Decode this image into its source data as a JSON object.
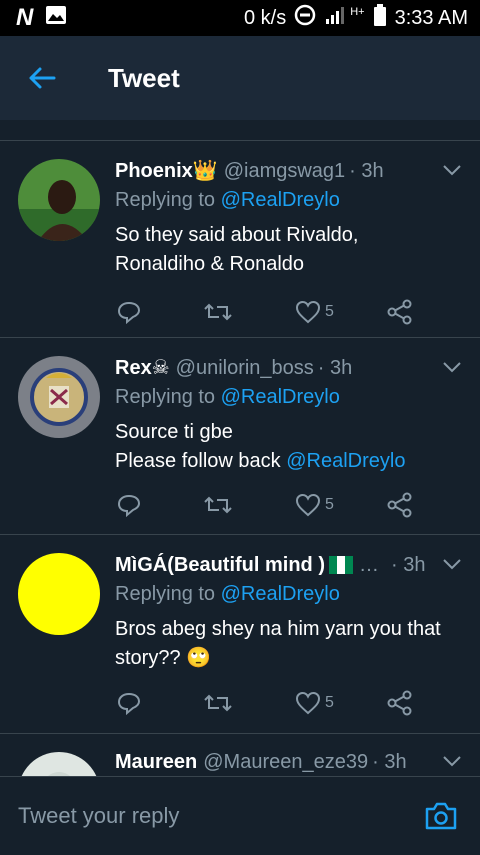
{
  "statusbar": {
    "speed": "0 k/s",
    "network": "H+",
    "time": "3:33 AM"
  },
  "appbar": {
    "title": "Tweet"
  },
  "tweets": [
    {
      "name": "Phoenix",
      "emoji": "👑",
      "handle": "@iamgswag1",
      "time": "· 3h",
      "replying_prefix": "Replying to",
      "replying_to": "@RealDreylo",
      "text_line1": "So they said about Rivaldo,",
      "text_line2": "Ronaldiho & Ronaldo",
      "likes": "5"
    },
    {
      "name": "Rex",
      "emoji": "☠",
      "handle": "@unilorin_boss",
      "time": "· 3h",
      "replying_prefix": "Replying to",
      "replying_to": "@RealDreylo",
      "text_line1": "Source ti gbe",
      "text_line2": "Please follow back",
      "text_mention": "@RealDreylo",
      "likes": "5"
    },
    {
      "name": "MìGÁ(Beautiful mind )",
      "ellipsis": "…",
      "time": "· 3h",
      "replying_prefix": "Replying to",
      "replying_to": "@RealDreylo",
      "text_line1": "Bros abeg shey na him yarn you that",
      "text_line2": "story??",
      "text_emoji": "🙄",
      "likes": "5"
    },
    {
      "name": "Maureen",
      "handle": "@Maureen_eze39",
      "time": "· 3h"
    }
  ],
  "composer": {
    "placeholder": "Tweet your reply"
  },
  "colors": {
    "background": "#15202b",
    "accent": "#1da1f2",
    "muted": "#8899a6",
    "divider": "#38444d",
    "avatar_yellow": "#ffff00"
  }
}
